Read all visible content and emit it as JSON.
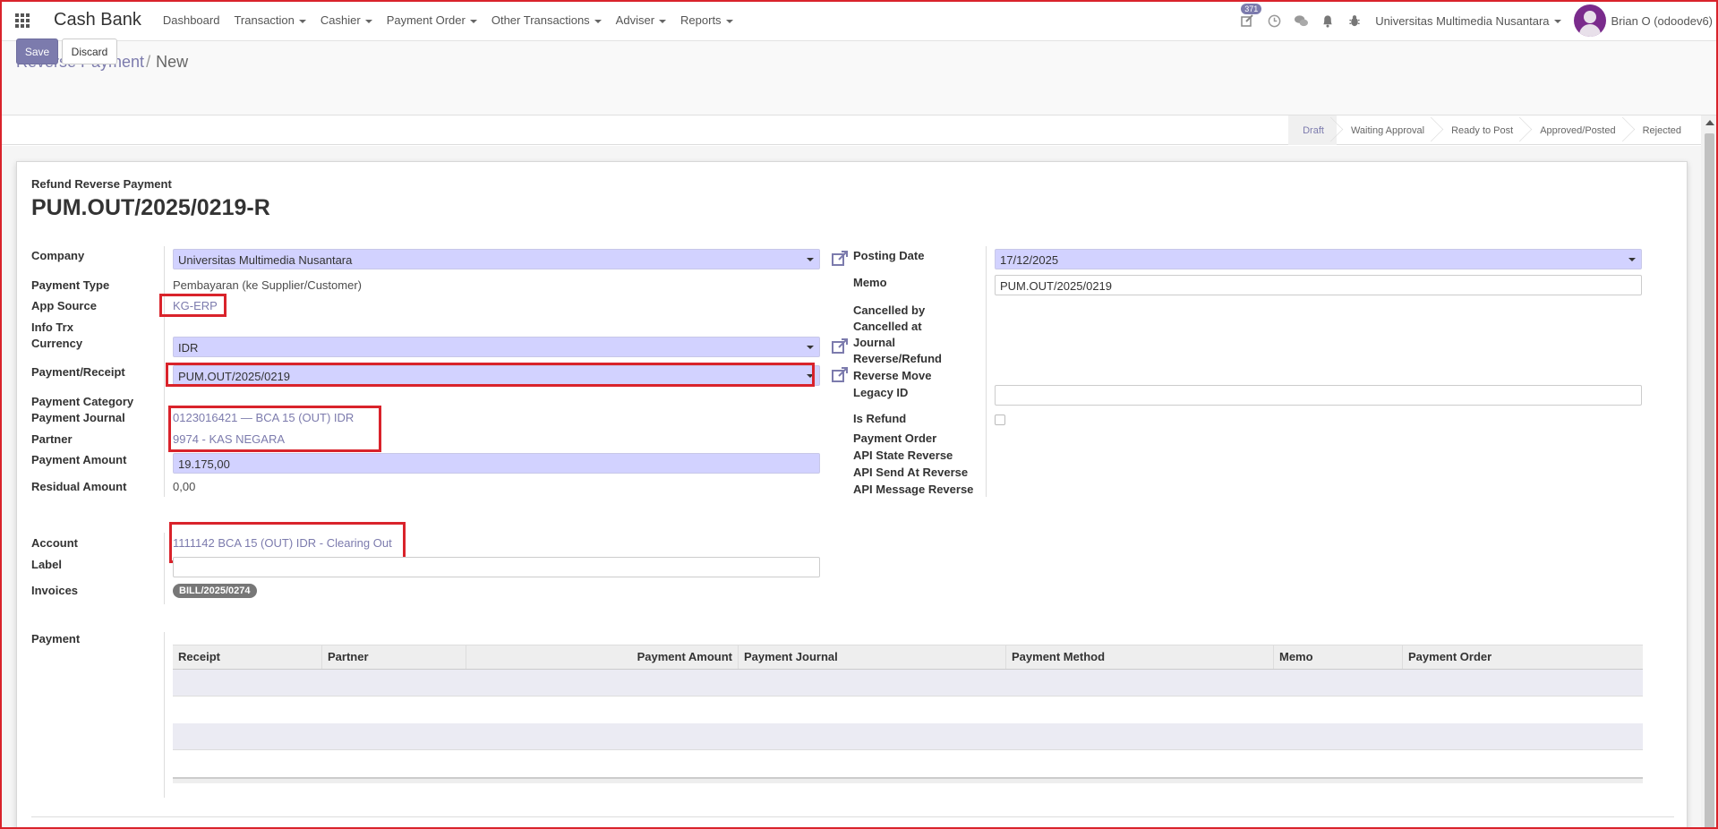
{
  "navbar": {
    "app_name": "Cash Bank",
    "menu": [
      "Dashboard",
      "Transaction",
      "Cashier",
      "Payment Order",
      "Other Transactions",
      "Adviser",
      "Reports"
    ],
    "badge_count": "371",
    "company": "Universitas Multimedia Nusantara",
    "user": "Brian O (odoodev6)"
  },
  "breadcrumb": {
    "parent": "Reverse Payment",
    "sep": "/",
    "current": "New"
  },
  "buttons": {
    "save": "Save",
    "discard": "Discard"
  },
  "status_stages": [
    "Draft",
    "Waiting Approval",
    "Ready to Post",
    "Approved/Posted",
    "Rejected"
  ],
  "active_stage": "Draft",
  "form": {
    "subtitle": "Refund  Reverse Payment",
    "title": "PUM.OUT/2025/0219-R",
    "left": {
      "company_label": "Company",
      "company": "Universitas Multimedia Nusantara",
      "payment_type_label": "Payment Type",
      "payment_type": "Pembayaran (ke Supplier/Customer)",
      "app_source_label": "App Source",
      "app_source": "KG-ERP",
      "info_trx_label": "Info Trx",
      "currency_label": "Currency",
      "currency": "IDR",
      "payment_receipt_label": "Payment/Receipt",
      "payment_receipt": "PUM.OUT/2025/0219",
      "payment_category_label": "Payment Category",
      "payment_journal_label": "Payment Journal",
      "payment_journal": "0123016421 — BCA 15 (OUT) IDR",
      "partner_label": "Partner",
      "partner": "9974 - KAS NEGARA",
      "payment_amount_label": "Payment Amount",
      "payment_amount": "19.175,00",
      "residual_amount_label": "Residual Amount",
      "residual_amount": "0,00",
      "account_label": "Account",
      "account": "1111142 BCA 15 (OUT) IDR - Clearing Out",
      "label_label": "Label",
      "label_value": "",
      "invoices_label": "Invoices",
      "invoice_tag": "BILL/2025/0274",
      "payment_label": "Payment"
    },
    "right": {
      "posting_date_label": "Posting Date",
      "posting_date": "17/12/2025",
      "memo_label": "Memo",
      "memo": "PUM.OUT/2025/0219",
      "cancelled_by_label": "Cancelled by",
      "cancelled_at_label": "Cancelled at",
      "journal_label": "Journal",
      "reverse_refund_label": "Reverse/Refund",
      "reverse_move_label": "Reverse Move",
      "legacy_id_label": "Legacy ID",
      "legacy_id": "",
      "is_refund_label": "Is Refund",
      "is_refund": false,
      "payment_order_label": "Payment Order",
      "api_state_label": "API State Reverse",
      "api_send_label": "API Send At Reverse",
      "api_message_label": "API Message Reverse"
    }
  },
  "payment_table": {
    "columns": [
      "Receipt",
      "Partner",
      "Payment Amount",
      "Payment Journal",
      "Payment Method",
      "Memo",
      "Payment Order"
    ],
    "rows": []
  }
}
